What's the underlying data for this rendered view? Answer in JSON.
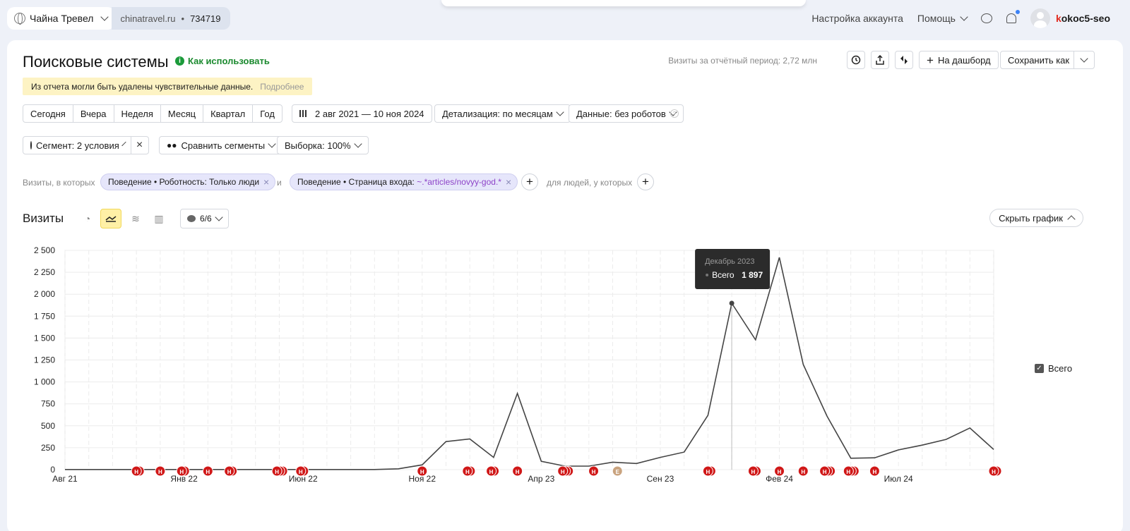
{
  "topbar": {
    "counter_name": "Чайна Тревел",
    "site": "chinatravel.ru",
    "separator": "•",
    "counter_id": "734719",
    "account_settings": "Настройка аккаунта",
    "help": "Помощь",
    "user_first": "k",
    "user_rest": "okoc5-seo"
  },
  "header": {
    "title": "Поисковые системы",
    "how_to": "Как использовать",
    "visits_total": "Визиты за отчётный период: 2,72 млн",
    "to_dashboard": "На дашборд",
    "save_as": "Сохранить как"
  },
  "notice": {
    "text": "Из отчета могли быть удалены чувствительные данные.",
    "more": "Подробнее"
  },
  "filters": {
    "periods": [
      "Сегодня",
      "Вчера",
      "Неделя",
      "Месяц",
      "Квартал",
      "Год"
    ],
    "date_range": "2 авг 2021 — 10 ноя 2024",
    "detail": "Детализация: по месяцам",
    "data": "Данные: без роботов",
    "segment": "Сегмент: 2 условия",
    "compare": "Сравнить сегменты",
    "sample": "Выборка: 100%"
  },
  "conditions": {
    "label_visits": "Визиты, в которых",
    "chip1": "Поведение • Роботность: Только люди",
    "and": "и",
    "chip2_prefix": "Поведение • Страница входа:",
    "chip2_value": "~.*articles/novyy-god.*",
    "label_people": "для людей, у которых"
  },
  "chart_section": {
    "title": "Визиты",
    "notes": "6/6",
    "hide_chart": "Скрыть график",
    "legend": "Всего"
  },
  "tooltip": {
    "month": "Декабрь 2023",
    "series": "Всего",
    "value": "1 897"
  },
  "chart_data": {
    "type": "line",
    "x": [
      "2021-08",
      "2021-09",
      "2021-10",
      "2021-11",
      "2021-12",
      "2022-01",
      "2022-02",
      "2022-03",
      "2022-04",
      "2022-05",
      "2022-06",
      "2022-07",
      "2022-08",
      "2022-09",
      "2022-10",
      "2022-11",
      "2022-12",
      "2023-01",
      "2023-02",
      "2023-03",
      "2023-04",
      "2023-05",
      "2023-06",
      "2023-07",
      "2023-08",
      "2023-09",
      "2023-10",
      "2023-11",
      "2023-12",
      "2024-01",
      "2024-02",
      "2024-03",
      "2024-04",
      "2024-05",
      "2024-06",
      "2024-07",
      "2024-08",
      "2024-09",
      "2024-10",
      "2024-11"
    ],
    "series": [
      {
        "name": "Всего",
        "color": "#444444",
        "values": [
          2,
          2,
          2,
          2,
          2,
          2,
          2,
          2,
          2,
          2,
          2,
          2,
          2,
          2,
          10,
          55,
          320,
          350,
          140,
          870,
          95,
          40,
          40,
          85,
          70,
          140,
          200,
          620,
          1897,
          1480,
          2420,
          1200,
          610,
          130,
          135,
          225,
          280,
          345,
          475,
          230
        ]
      }
    ],
    "ylim": [
      0,
      2500
    ],
    "yticks": [
      0,
      250,
      500,
      750,
      1000,
      1250,
      1500,
      1750,
      2000,
      2250,
      2500
    ],
    "ytick_labels": [
      "0",
      "250",
      "500",
      "750",
      "1 000",
      "1 250",
      "1 500",
      "1 750",
      "2 000",
      "2 250",
      "2 500"
    ],
    "xtick_labels": [
      {
        "label": "Авг 21",
        "x": "2021-08"
      },
      {
        "label": "Янв 22",
        "x": "2022-01"
      },
      {
        "label": "Июн 22",
        "x": "2022-06"
      },
      {
        "label": "Ноя 22",
        "x": "2022-11"
      },
      {
        "label": "Апр 23",
        "x": "2023-04"
      },
      {
        "label": "Сен 23",
        "x": "2023-09"
      },
      {
        "label": "Фев 24",
        "x": "2023-02"
      },
      {
        "label": "Июл 24",
        "x": "2024-07"
      }
    ],
    "grid": true,
    "legend": "right",
    "annotation_markers": [
      {
        "x": 3.0,
        "n": 2,
        "t": "Н"
      },
      {
        "x": 4.0,
        "n": 1,
        "t": "Н"
      },
      {
        "x": 4.9,
        "n": 2,
        "t": "Н"
      },
      {
        "x": 6.0,
        "n": 1,
        "t": "Н"
      },
      {
        "x": 6.9,
        "n": 2,
        "t": "Н"
      },
      {
        "x": 8.9,
        "n": 3,
        "t": "Н"
      },
      {
        "x": 9.9,
        "n": 2,
        "t": "Н"
      },
      {
        "x": 15.0,
        "n": 1,
        "t": "Н"
      },
      {
        "x": 16.9,
        "n": 2,
        "t": "Н"
      },
      {
        "x": 17.9,
        "n": 2,
        "t": "Н"
      },
      {
        "x": 19.0,
        "n": 1,
        "t": "Н"
      },
      {
        "x": 20.9,
        "n": 3,
        "t": "Н"
      },
      {
        "x": 22.2,
        "n": 1,
        "t": "Н"
      },
      {
        "x": 23.2,
        "n": 1,
        "t": "Е",
        "color": "#c9a37f"
      },
      {
        "x": 27.0,
        "n": 2,
        "t": "Н"
      },
      {
        "x": 28.9,
        "n": 2,
        "t": "Н"
      },
      {
        "x": 30.0,
        "n": 1,
        "t": "Н"
      },
      {
        "x": 31.0,
        "n": 1,
        "t": "Н"
      },
      {
        "x": 31.9,
        "n": 3,
        "t": "Н"
      },
      {
        "x": 32.9,
        "n": 3,
        "t": "Н"
      },
      {
        "x": 34.0,
        "n": 1,
        "t": "Н"
      },
      {
        "x": 39.0,
        "n": 2,
        "t": "Н"
      }
    ]
  }
}
